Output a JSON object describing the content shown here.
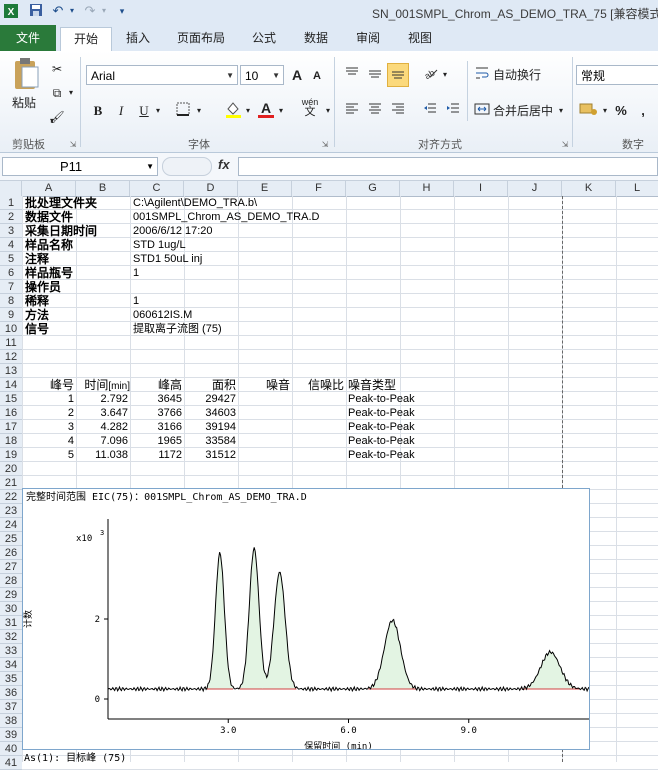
{
  "window": {
    "title": "SN_001SMPL_Chrom_AS_DEMO_TRA_75  [兼容模式"
  },
  "qat": {
    "save_icon": "save-icon",
    "undo_icon": "undo-icon",
    "redo_icon": "redo-icon",
    "customize_icon": "chevron-down-icon"
  },
  "tabs": [
    {
      "label": "文件"
    },
    {
      "label": "开始"
    },
    {
      "label": "插入"
    },
    {
      "label": "页面布局"
    },
    {
      "label": "公式"
    },
    {
      "label": "数据"
    },
    {
      "label": "审阅"
    },
    {
      "label": "视图"
    }
  ],
  "ribbon": {
    "clipboard": {
      "paste_label": "粘贴",
      "group_label": "剪贴板"
    },
    "font": {
      "name": "Arial",
      "size": "10",
      "group_label": "字体",
      "bold": "B",
      "italic": "I",
      "underline": "U",
      "grow": "A",
      "shrink": "A",
      "phonetic": "wén"
    },
    "alignment": {
      "wrap_text": "自动换行",
      "merge_center": "合并后居中",
      "group_label": "对齐方式"
    },
    "number": {
      "format": "常规",
      "percent": "%",
      "comma": ",",
      "group_label": "数字"
    }
  },
  "formula_bar": {
    "name_box": "P11",
    "fx_label": "fx",
    "value": ""
  },
  "columns": [
    "A",
    "B",
    "C",
    "D",
    "E",
    "F",
    "G",
    "H",
    "I",
    "J",
    "K",
    "L"
  ],
  "rows": [
    "1",
    "2",
    "3",
    "4",
    "5",
    "6",
    "7",
    "8",
    "9",
    "10",
    "11",
    "12",
    "13",
    "14",
    "15",
    "16",
    "17",
    "18",
    "19",
    "20",
    "21",
    "22",
    "23",
    "24",
    "25",
    "26",
    "27",
    "28",
    "29",
    "30",
    "31",
    "32",
    "33",
    "34",
    "35",
    "36",
    "37",
    "38",
    "39",
    "40",
    "41"
  ],
  "header_info": [
    {
      "label": "批处理文件夹",
      "value": "C:\\Agilent\\DEMO_TRA.b\\"
    },
    {
      "label": "数据文件",
      "value": "001SMPL_Chrom_AS_DEMO_TRA.D"
    },
    {
      "label": "采集日期时间",
      "value": "2006/6/12 17:20"
    },
    {
      "label": "样品名称",
      "value": "STD 1ug/L"
    },
    {
      "label": "注释",
      "value": "STD1 50uL inj"
    },
    {
      "label": "样品瓶号",
      "value": "1"
    },
    {
      "label": "操作员",
      "value": ""
    },
    {
      "label": "稀释",
      "value": "1"
    },
    {
      "label": "方法",
      "value": "060612IS.M"
    },
    {
      "label": "信号",
      "value": "提取离子流图 (75)"
    }
  ],
  "peak_table": {
    "headers": [
      "峰号",
      "RT(min)",
      "峰高",
      "面积",
      "噪音",
      "信噪比",
      "噪音类型"
    ],
    "header_rt_prefix": "时间",
    "header_rt_unit": "[min]",
    "rows": [
      {
        "no": "1",
        "rt": "2.792",
        "height": "3645",
        "area": "29427",
        "noise_type": "Peak-to-Peak"
      },
      {
        "no": "2",
        "rt": "3.647",
        "height": "3766",
        "area": "34603",
        "noise_type": "Peak-to-Peak"
      },
      {
        "no": "3",
        "rt": "4.282",
        "height": "3166",
        "area": "39194",
        "noise_type": "Peak-to-Peak"
      },
      {
        "no": "4",
        "rt": "7.096",
        "height": "1965",
        "area": "33584",
        "noise_type": "Peak-to-Peak"
      },
      {
        "no": "5",
        "rt": "11.038",
        "height": "1172",
        "area": "31512",
        "noise_type": "Peak-to-Peak"
      }
    ]
  },
  "chart_title": "完整时间范围 EIC(75)：001SMPL_Chrom_AS_DEMO_TRA.D",
  "footer_note": "As(1): 目标峰 (75)",
  "chart_data": {
    "type": "line",
    "title": "完整时间范围 EIC(75)：001SMPL_Chrom_AS_DEMO_TRA.D",
    "xlabel": "保留时间 (min)",
    "ylabel": "计数",
    "y_multiplier": "x10",
    "y_exponent": "3",
    "xlim": [
      0,
      12
    ],
    "ylim": [
      0,
      4
    ],
    "xticks": [
      "3.0",
      "6.0",
      "9.0"
    ],
    "xtick_values": [
      3,
      6,
      9
    ],
    "yticks": [
      "0",
      "2"
    ],
    "ytick_values": [
      0,
      2
    ],
    "baseline": 0.25,
    "peaks": [
      {
        "rt": 2.792,
        "height": 3.645,
        "width": 0.11
      },
      {
        "rt": 3.647,
        "height": 3.766,
        "width": 0.12
      },
      {
        "rt": 4.282,
        "height": 3.166,
        "width": 0.14
      },
      {
        "rt": 7.096,
        "height": 1.965,
        "width": 0.2
      },
      {
        "rt": 11.038,
        "height": 1.172,
        "width": 0.24
      }
    ],
    "colors": {
      "trace": "#000000",
      "fill": "#e3f4e3",
      "integration": "#d04040"
    }
  }
}
